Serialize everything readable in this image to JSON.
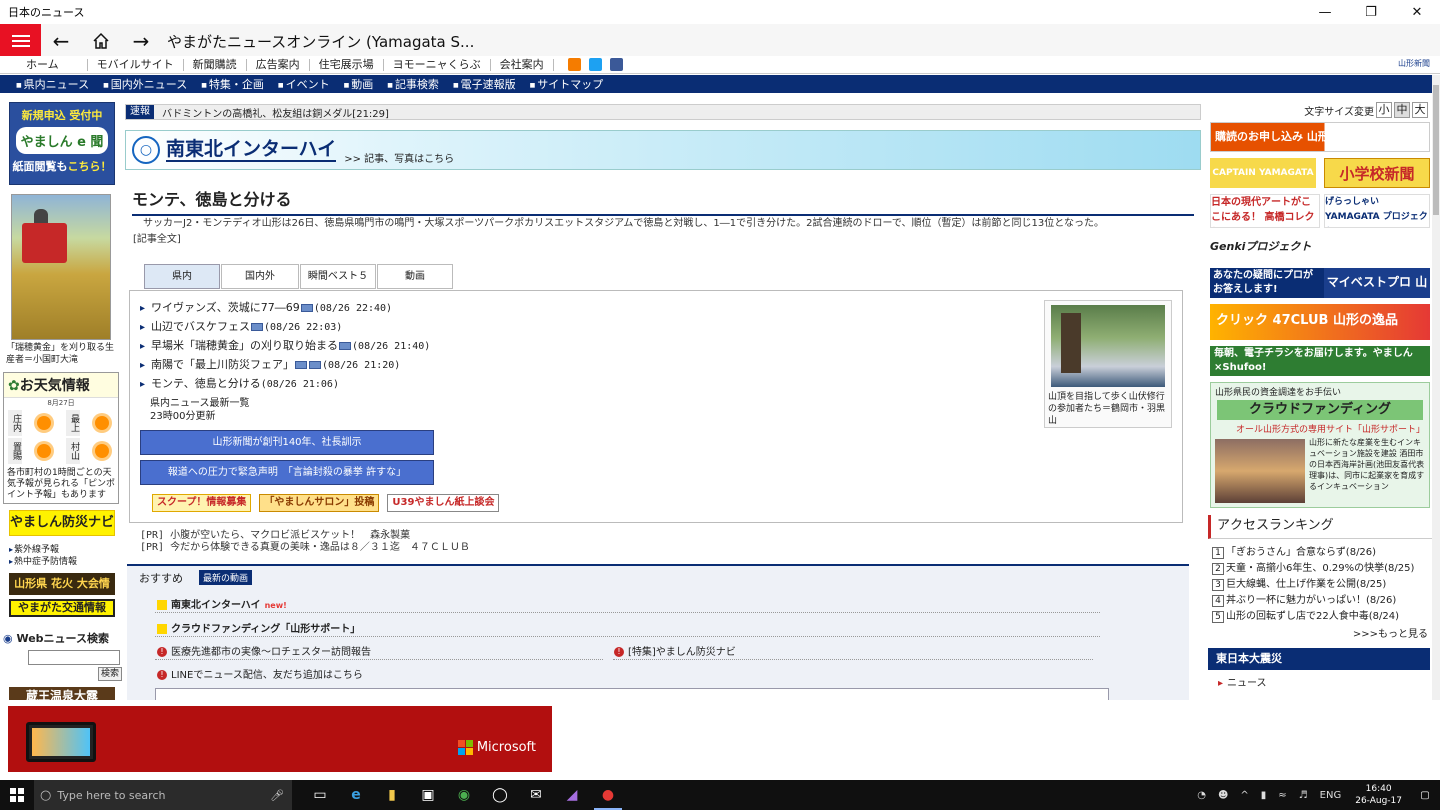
{
  "window": {
    "title": "日本のニュース"
  },
  "app": {
    "page_title": "やまがたニュースオンライン (Yamagata S..."
  },
  "site_menu": [
    "ホーム",
    "モバイルサイト",
    "新聞購読",
    "広告案内",
    "住宅展示場",
    "ヨモーニャくらぶ",
    "会社案内"
  ],
  "site_logo": "山形新聞",
  "category_nav": [
    "県内ニュース",
    "国内外ニュース",
    "特集・企画",
    "イベント",
    "動画",
    "記事検索",
    "電子速報版",
    "サイトマップ"
  ],
  "left": {
    "ebanner": {
      "line1": "新規申込 受付中",
      "line2": "やましん e 聞",
      "line3a": "紙面閲覧も",
      "line3b": "こちら！"
    },
    "photo_caption": "「瑞穂黄金」を刈り取る生産者＝小国町大滝",
    "weather": {
      "title": "お天気情報",
      "date": "8月27日",
      "cities": [
        "庄内",
        "最上",
        "置賜",
        "村山"
      ],
      "note": "各市町村の1時間ごとの天気予報が見られる「ピンポイント予報」もあります"
    },
    "bosai": "やましん防災ナビ",
    "links": [
      "紫外線予報",
      "熱中症予防情報"
    ],
    "hanabi": "山形県 花火 大会情報",
    "kotsu": "やまがた交通情報",
    "websearch": {
      "label": "Webニュース検索",
      "button": "検索",
      "placeholder": ""
    },
    "bottom": "蔵王温泉大露"
  },
  "breaking": {
    "label": "速報",
    "text": "バドミントンの高橋礼、松友組は銅メダル[21:29]"
  },
  "interhigh": {
    "title": "南東北インターハイ",
    "sub": ">> 記事、写真はこちら"
  },
  "article": {
    "headline": "モンテ、徳島と分ける",
    "lead": "サッカーJ2・モンテディオ山形は26日、徳島県鳴門市の鳴門・大塚スポーツパークポカリスエットスタジアムで徳島と対戦し、1―1で引き分けた。2試合連続のドローで、順位（暫定）は前節と同じ13位となった。",
    "full_link": "[記事全文]"
  },
  "tabs": [
    "県内",
    "国内外",
    "瞬間ベスト５",
    "動画"
  ],
  "news": [
    {
      "title": "ワイヴァンズ、茨城に77―69",
      "time": "(08/26 22:40)"
    },
    {
      "title": "山辺でバスケフェス",
      "time": "(08/26 22:03)"
    },
    {
      "title": "早場米「瑞穂黄金」の刈り取り始まる",
      "time": "(08/26 21:40)"
    },
    {
      "title": "南陽で「最上川防災フェア」",
      "time": "(08/26 21:20)"
    },
    {
      "title": "モンテ、徳島と分ける",
      "time": "(08/26 21:06)"
    }
  ],
  "news_more": {
    "label": "県内ニュース最新一覧",
    "updated": "23時00分更新"
  },
  "blue_buttons": [
    "山形新聞が創刊140年、社長訓示",
    "報道への圧力で緊急声明　「言論封殺の暴挙 許すな」"
  ],
  "promos": [
    "スクープ！情報募集",
    "「やましんサロン」投稿",
    "U39やましん紙上談会"
  ],
  "side_photo_caption": "山頂を目指して歩く山伏修行の参加者たち＝鶴岡市・羽黒山",
  "pr": [
    "[PR] 小腹が空いたら、マクロビ派ビスケット！　森永製菓",
    "[PR] 今だから体験できる真夏の美味・逸品は８／３１迄　４７ＣＬＵＢ"
  ],
  "osusume": {
    "title": "おすすめ",
    "badge": "最新の動画",
    "items": [
      "南東北インターハイ",
      "クラウドファンディング「山形サポート」"
    ],
    "new_label": "new!",
    "links": [
      "医療先進都市の実像～ロチェスター訪問報告",
      "[特集]やましん防災ナビ",
      "LINEでニュース配信、友だち追加はこちら"
    ]
  },
  "right": {
    "fontsize": {
      "label": "文字サイズ変更",
      "small": "小",
      "medium": "中",
      "large": "大"
    },
    "banners": [
      "購読のお申し込み 山形新聞",
      "CAPTAIN YAMAGATA",
      "小学校新聞",
      "日本の現代アートがここにある！ 高橋コレクション",
      "げらっしゃい YAMAGATA プロジェクト",
      "Genkiプロジェクト",
      "あなたの疑問にプロがお答えします!",
      "マイベストプロ 山形",
      "クリック 47CLUB 山形の逸品",
      "毎朝、電子チラシをお届けします。やましん×Shufoo!",
      "山形県民の資金調達をお手伝い",
      "クラウドファンディング",
      "オール山形方式の専用サイト「山形サポート」",
      "山形に新たな産業を生むインキュベーション施設を建設 酒田市の日本西海岸計画(池田友喜代表理事)は、同市に起業家を育成するインキュベーション"
    ],
    "ranking": {
      "title": "アクセスランキング",
      "items": [
        "「ぎおうさん」合意ならず(8/26)",
        "天童・高擶小6年生、0.29%の快挙(8/25)",
        "巨大線蝿、仕上げ作業を公開(8/25)",
        "丼ぶり一杯に魅力がいっぱい！(8/26)",
        "山形の回転ずし店で22人食中毒(8/24)"
      ],
      "more": ">>>もっと見る"
    },
    "quake": {
      "title": "東日本大震災",
      "link": "ニュース"
    }
  },
  "ad": {
    "brand": "Microsoft"
  },
  "taskbar": {
    "search_placeholder": "Type here to search",
    "lang": "ENG",
    "time": "16:40",
    "date": "26-Aug-17"
  },
  "colors": {
    "navy": "#0a2d74",
    "hamburger_red": "#e81123",
    "ad_red": "#b20f0f"
  }
}
